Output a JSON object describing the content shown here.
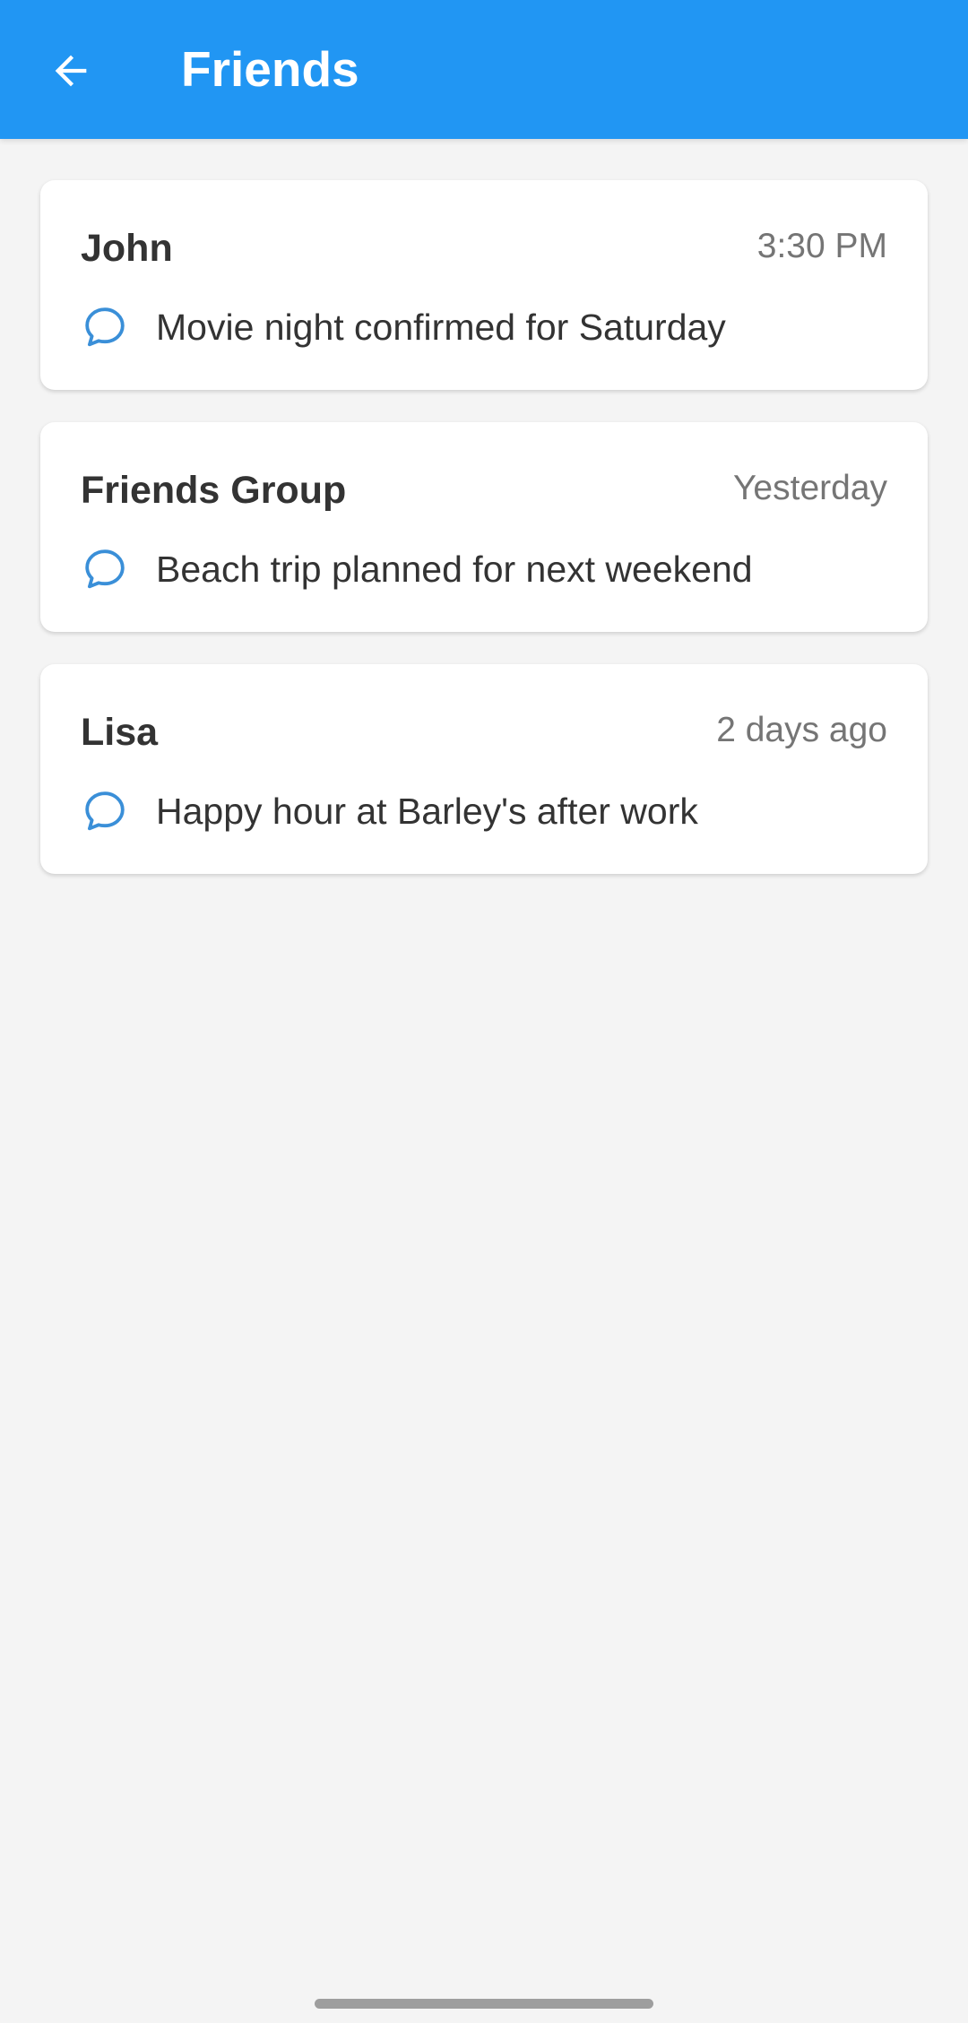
{
  "app_bar": {
    "title": "Friends",
    "back_icon": "arrow-left-icon",
    "background_color": "#2196f3"
  },
  "conversations": [
    {
      "name": "John",
      "time": "3:30 PM",
      "message": "Movie night confirmed for Saturday",
      "icon": "chat-bubble-icon"
    },
    {
      "name": "Friends Group",
      "time": "Yesterday",
      "message": "Beach trip planned for next weekend",
      "icon": "chat-bubble-icon"
    },
    {
      "name": "Lisa",
      "time": "2 days ago",
      "message": "Happy hour at Barley's after work",
      "icon": "chat-bubble-icon"
    }
  ],
  "colors": {
    "accent": "#2196f3",
    "icon": "#3a8fd8",
    "background": "#f4f4f4"
  }
}
